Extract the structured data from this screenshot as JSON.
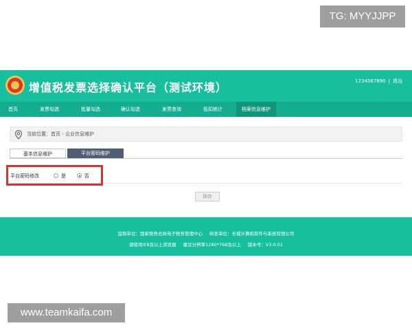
{
  "overlay": {
    "tg_badge": "TG: MYYJJPP",
    "watermark": "www.teamkaifa.com"
  },
  "header": {
    "title": "增值税发票选择确认平台（测试环境）",
    "user_id": "1234567890",
    "separator": "|",
    "logout_label": "退出",
    "logo_icon": "tax-emblem-icon"
  },
  "nav": {
    "items": [
      {
        "label": "首页",
        "active": false
      },
      {
        "label": "发票勾选",
        "active": false
      },
      {
        "label": "批量勾选",
        "active": false
      },
      {
        "label": "确认勾选",
        "active": false
      },
      {
        "label": "发票查询",
        "active": false
      },
      {
        "label": "抵扣统计",
        "active": false
      },
      {
        "label": "档案信息维护",
        "active": true
      }
    ]
  },
  "breadcrumb": {
    "text": "当前位置：首页 - 企业信息维护",
    "icon": "location-pin-icon"
  },
  "tabs": [
    {
      "label": "基本信息维护",
      "active": false
    },
    {
      "label": "平台密码维护",
      "active": true
    }
  ],
  "form": {
    "field_label": "平台密码修改",
    "options": [
      {
        "label": "是",
        "checked": false
      },
      {
        "label": "否",
        "checked": true
      }
    ],
    "save_label": "保存"
  },
  "footer": {
    "supervisor": "监制单位：国家税务总局电子税务管理中心",
    "developer": "研发单位：长城计算机软件与系统有限公司",
    "browser": "请使用IE8及以上浏览器",
    "resolution": "建议分辨率1280*768及以上",
    "version": "版本号：V3.0.01"
  },
  "colors": {
    "primary": "#18bf9f",
    "nav": "#14ad8f",
    "active_tab": "#4f5e74",
    "highlight": "#d9312d"
  }
}
